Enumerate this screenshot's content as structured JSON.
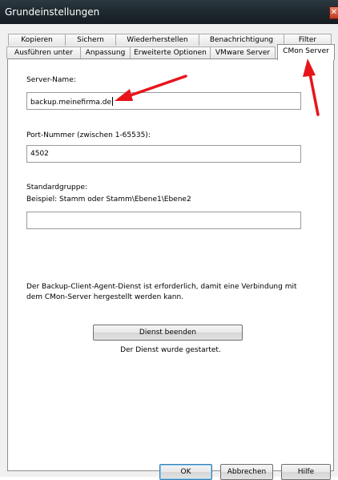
{
  "window": {
    "title": "Grundeinstellungen",
    "close_glyph": "✕"
  },
  "tabs": {
    "back_row": [
      "Kopieren",
      "Sichern",
      "Wiederherstellen",
      "Benachrichtigung",
      "Filter"
    ],
    "front_row": [
      "Ausführen unter",
      "Anpassung",
      "Erweiterte Optionen",
      "VMware Server"
    ],
    "active": "CMon Server"
  },
  "form": {
    "server_label": "Server-Name:",
    "server_value": "backup.meinefirma.de",
    "port_label": "Port-Nummer (zwischen 1-65535):",
    "port_value": "4502",
    "group_label": "Standardgruppe:",
    "group_example": "Beispiel: Stamm oder Stamm\\Ebene1\\Ebene2",
    "group_value": ""
  },
  "info": {
    "line1": "Der Backup-Client-Agent-Dienst ist erforderlich, damit eine Verbindung mit",
    "line2": "dem CMon-Server hergestellt werden kann."
  },
  "service": {
    "button_label": "Dienst beenden",
    "status": "Der Dienst wurde gestartet."
  },
  "footer": {
    "ok_label": "OK",
    "cancel_label": "Abbrechen",
    "help_label": "Hilfe"
  },
  "annotation_color": "#e8141b"
}
